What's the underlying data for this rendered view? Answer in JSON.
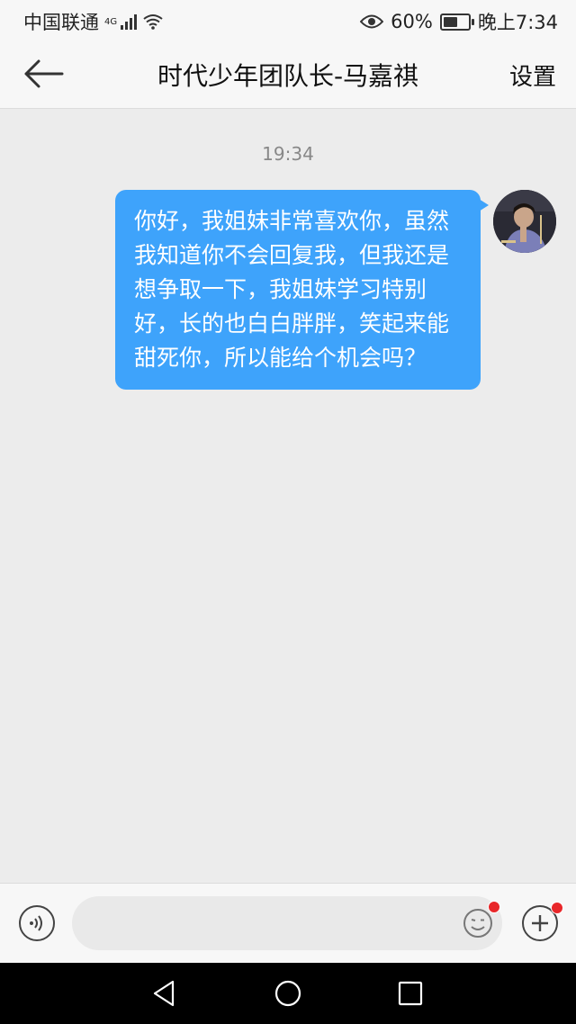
{
  "status_bar": {
    "carrier": "中国联通",
    "network": "4G",
    "battery_percent": "60%",
    "battery_level": 0.6,
    "time": "晚上7:34",
    "icons": [
      "signal-icon",
      "wifi-icon",
      "eye-icon",
      "battery-icon"
    ]
  },
  "header": {
    "title": "时代少年团队长-马嘉祺",
    "settings_label": "设置",
    "back_icon": "back-arrow-icon"
  },
  "chat": {
    "timestamp": "19:34",
    "messages": [
      {
        "sender": "self",
        "text": "你好，我姐妹非常喜欢你，虽然我知道你不会回复我，但我还是想争取一下，我姐妹学习特别好，长的也白白胖胖，笑起来能甜死你，所以能给个机会吗？"
      }
    ]
  },
  "input_bar": {
    "value": "",
    "placeholder": "",
    "icons": [
      "voice-icon",
      "emoji-icon",
      "plus-icon"
    ],
    "badge_color": "#e8272a"
  },
  "nav_bar": {
    "icons": [
      "nav-back-icon",
      "nav-home-icon",
      "nav-recents-icon"
    ]
  },
  "colors": {
    "bubble": "#3ea3fb",
    "background": "#ececec",
    "bars": "#f7f7f7"
  }
}
